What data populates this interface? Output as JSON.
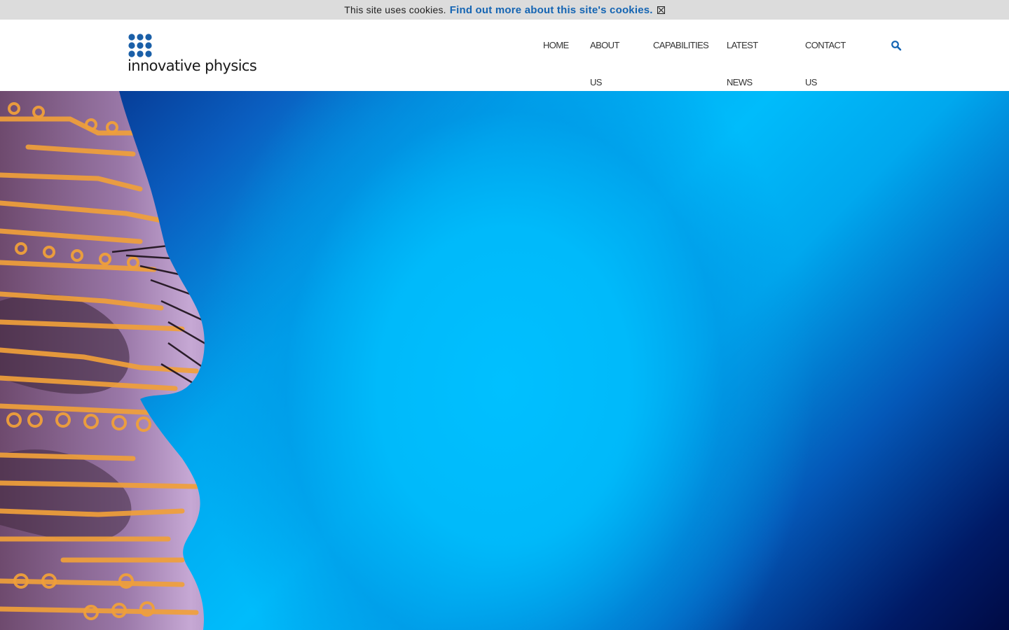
{
  "cookie_bar": {
    "message": "This site uses cookies.",
    "link_text": "Find out more about this site's cookies."
  },
  "header": {
    "logo": {
      "wordmark": "innovative physics",
      "brand_color": "#1a5fa8"
    },
    "nav": {
      "home": [
        "HOME"
      ],
      "about": [
        "ABOUT",
        "US"
      ],
      "capabilities": [
        "CAPABILITIES"
      ],
      "news": [
        "LATEST",
        "NEWS"
      ],
      "contact": [
        "CONTACT",
        "US"
      ]
    },
    "search_icon": "search-icon",
    "accent_color": "#1565b3"
  },
  "hero": {
    "image": "face-with-circuit-pattern",
    "background_color": "#00bcfb"
  }
}
